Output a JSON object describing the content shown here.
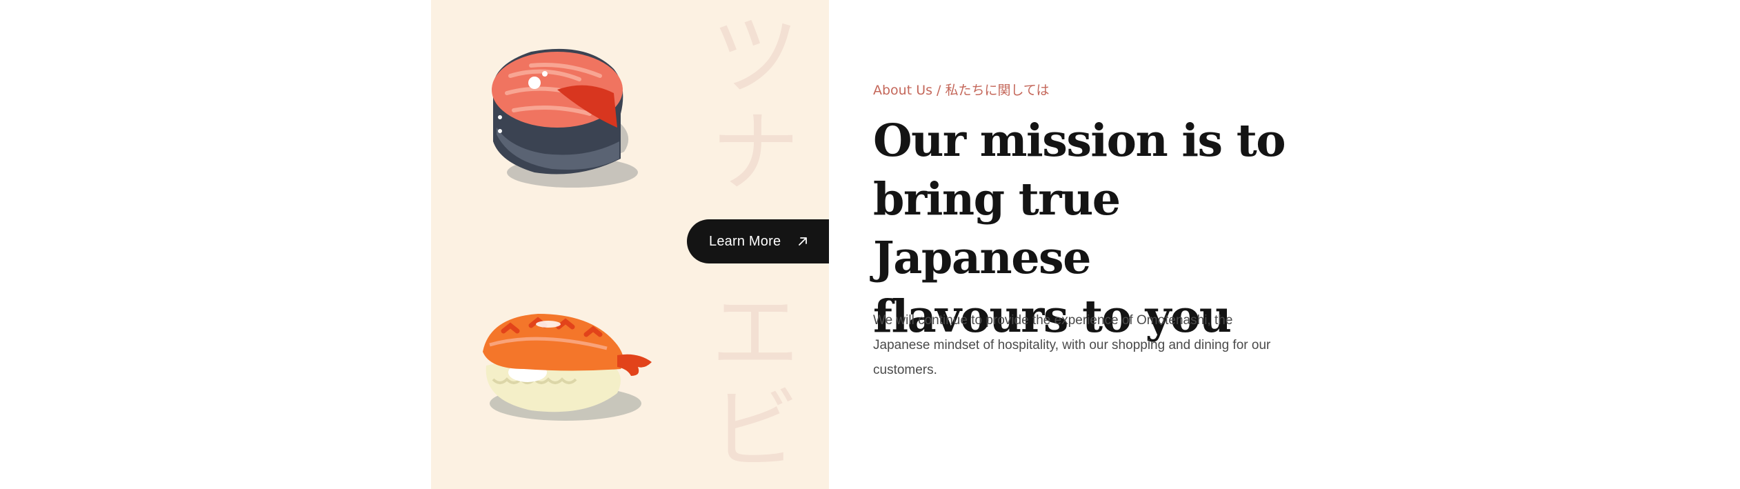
{
  "hero_panel": {
    "kana_top": [
      "ツ",
      "ナ"
    ],
    "kana_bottom": [
      "エ",
      "ビ"
    ],
    "colors": {
      "panel_bg": "#fcf1e2",
      "kana": "#f3e0d3"
    },
    "icons": [
      "salmon-sushi-icon",
      "ebi-sushi-icon"
    ]
  },
  "cta": {
    "label": "Learn More",
    "icon": "arrow-up-right-icon"
  },
  "about": {
    "eyebrow": "About Us / 私たちに関しては",
    "headline_lines": [
      "Our mission is to",
      "bring true Japanese",
      "flavours to you"
    ],
    "body": "We will continue to provide the experience of Omotenashi, the Japanese mindset of hospitality, with our shopping and dining for our customers."
  },
  "colors": {
    "accent": "#c4675a",
    "dark": "#141414",
    "text": "#4a4a4a"
  }
}
